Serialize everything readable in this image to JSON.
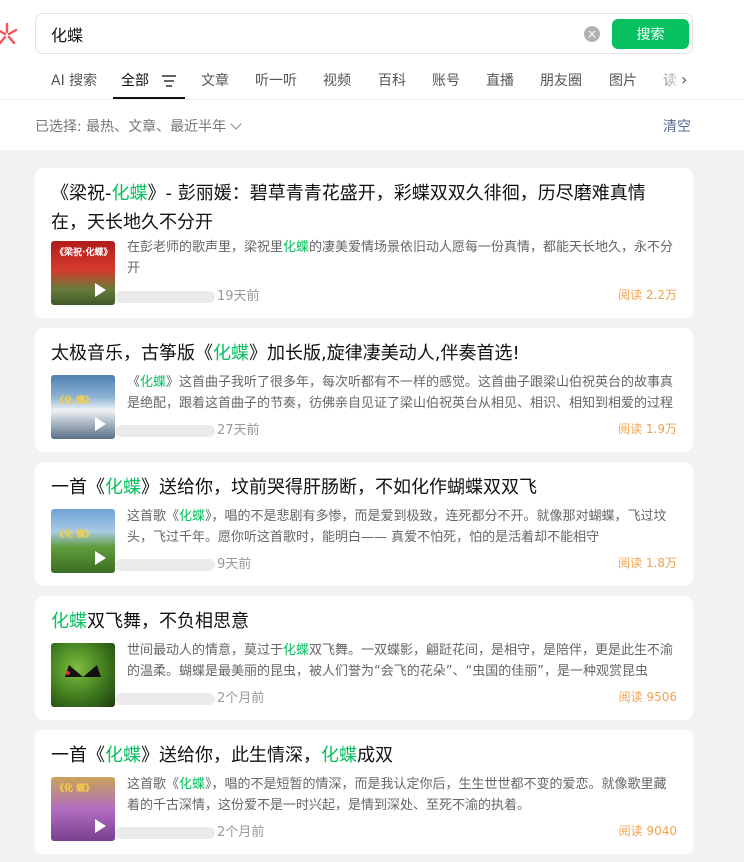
{
  "search": {
    "query": "化蝶",
    "button": "搜索"
  },
  "tabs": [
    "AI 搜索",
    "全部",
    "文章",
    "听一听",
    "视频",
    "百科",
    "账号",
    "直播",
    "朋友圈",
    "图片",
    "读"
  ],
  "filter": {
    "label": "已选择:",
    "value": "最热、文章、最近半年",
    "clear": "清空"
  },
  "results": [
    {
      "title_pre": "《梁祝-",
      "title_hl": "化蝶",
      "title_post": "》- 彭丽媛：碧草青青花盛开，彩蝶双双久徘徊，历尽磨难真情在，天长地久不分开",
      "thumb_label": "《梁祝·化蝶》",
      "desc_pre": "在彭老师的歌声里，梁祝里",
      "desc_hl": "化蝶",
      "desc_post": "的凄美爱情场景依旧动人愿每一份真情，都能天长地久，永不分开",
      "time": "19天前",
      "reads": "阅读 2.2万"
    },
    {
      "title_pre": "太极音乐，古筝版《",
      "title_hl": "化蝶",
      "title_post": "》加长版,旋律凄美动人,伴奏首选!",
      "thumb_label": "《化 蝶》",
      "desc_pre": "《",
      "desc_hl": "化蝶",
      "desc_post": "》这首曲子我听了很多年，每次听都有不一样的感觉。这首曲子跟梁山伯祝英台的故事真是绝配，跟着这首曲子的节奏，彷佛亲自见证了梁山伯祝英台从相见、相识、相知到相爱的过程",
      "time": "27天前",
      "reads": "阅读 1.9万"
    },
    {
      "title_pre": "一首《",
      "title_hl": "化蝶",
      "title_post": "》送给你，坟前哭得肝肠断，不如化作蝴蝶双双飞",
      "thumb_label": "《化 蝶》",
      "desc_pre": "这首歌《",
      "desc_hl": "化蝶",
      "desc_post": "》，唱的不是悲剧有多惨，而是爱到极致，连死都分不开。就像那对蝴蝶，飞过坟头，飞过千年。愿你听这首歌时，能明白—— 真爱不怕死，怕的是活着却不能相守",
      "time": "9天前",
      "reads": "阅读 1.8万"
    },
    {
      "title_pre": "",
      "title_hl": "化蝶",
      "title_post": "双飞舞，不负相思意",
      "thumb_label": "",
      "desc_pre": "世间最动人的情意，莫过于",
      "desc_hl": "化蝶",
      "desc_post": "双飞舞。一双蝶影，翩跹花间，是相守，是陪伴，更是此生不渝的温柔。蝴蝶是最美丽的昆虫，被人们誉为“会飞的花朵”、“虫国的佳丽”，是一种观赏昆虫",
      "time": "2个月前",
      "reads": "阅读 9506"
    },
    {
      "title_pre": "一首《",
      "title_hl": "化蝶",
      "title_post": "》送给你，此生情深，",
      "title_hl2": "化蝶",
      "title_post2": "成双",
      "thumb_label": "《化 蝶》",
      "desc_pre": "这首歌《",
      "desc_hl": "化蝶",
      "desc_post": "》，唱的不是短暂的情深，而是我认定你后，生生世世都不变的爱恋。就像歌里藏着的千古深情，这份爱不是一时兴起，是情到深处、至死不渝的执着。",
      "time": "2个月前",
      "reads": "阅读 9040"
    }
  ]
}
